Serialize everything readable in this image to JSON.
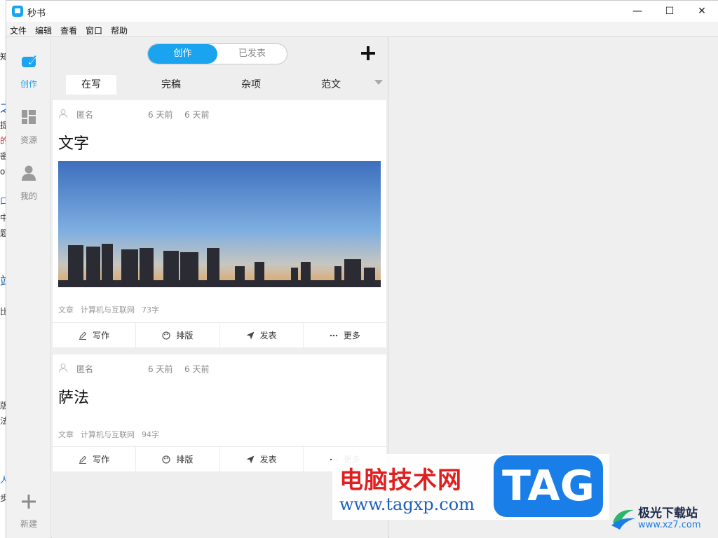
{
  "background_page": {
    "fragments": [
      "知",
      "之",
      "提",
      "的",
      "密",
      "of",
      "口",
      "中",
      "题",
      "站",
      "比",
      "版",
      "法",
      "人",
      "步"
    ]
  },
  "window": {
    "title": "秒书",
    "controls": [
      "—",
      "☐",
      "✕"
    ]
  },
  "menu": [
    "文件",
    "编辑",
    "查看",
    "窗口",
    "帮助"
  ],
  "sidebar": {
    "items": [
      {
        "label": "创作",
        "icon": "compose-icon",
        "active": true
      },
      {
        "label": "资源",
        "icon": "grid-icon",
        "active": false
      },
      {
        "label": "我的",
        "icon": "user-icon",
        "active": false
      }
    ],
    "new_label": "新建"
  },
  "segment": {
    "left": "创作",
    "right": "已发表"
  },
  "category_tabs": [
    "在写",
    "完稿",
    "杂项",
    "范文"
  ],
  "cards": [
    {
      "author": "匿名",
      "created": "6 天前",
      "updated": "6 天前",
      "title": "文字",
      "has_image": true,
      "type": "文章",
      "category": "计算机与互联网",
      "count": "73字"
    },
    {
      "author": "匿名",
      "created": "6 天前",
      "updated": "6 天前",
      "title": "萨法",
      "has_image": false,
      "type": "文章",
      "category": "计算机与互联网",
      "count": "94字"
    }
  ],
  "actions": [
    "写作",
    "排版",
    "发表",
    "更多"
  ],
  "watermark": {
    "cn": "电脑技术网",
    "url": "www.tagxp.com",
    "tag": "TAG",
    "site_cn": "极光下载站",
    "site_url": "www.xz7.com"
  },
  "colors": {
    "accent": "#1aa4f0",
    "watermark_red": "#e02020",
    "watermark_blue": "#1a7ee8"
  }
}
